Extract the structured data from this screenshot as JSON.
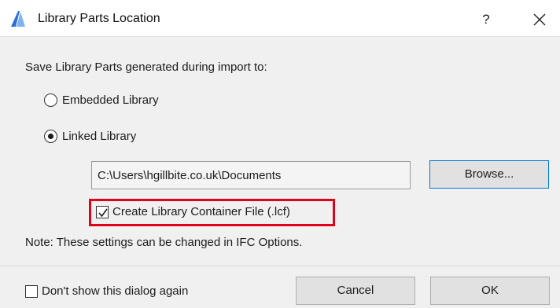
{
  "window": {
    "title": "Library Parts Location",
    "help_label": "?",
    "app_icon": "archicad-app-icon",
    "close_icon": "close-icon"
  },
  "content": {
    "prompt": "Save Library Parts generated during import to:",
    "options": [
      {
        "label": "Embedded Library",
        "selected": false
      },
      {
        "label": "Linked Library",
        "selected": true
      }
    ],
    "path_value": "C:\\Users\\hgillbite.co.uk\\Documents",
    "browse_label": "Browse...",
    "container_checkbox": {
      "label": "Create Library Container File (.lcf)",
      "checked": true
    },
    "note": "Note: These settings can be changed in IFC Options."
  },
  "footer": {
    "dont_show": {
      "label": "Don't show this dialog again",
      "checked": false
    },
    "cancel_label": "Cancel",
    "ok_label": "OK"
  },
  "colors": {
    "highlight": "#e0001a",
    "focus_border": "#0078d7",
    "dialog_bg": "#f0f0f0",
    "app_icon_blue": "#2a6fd6"
  }
}
